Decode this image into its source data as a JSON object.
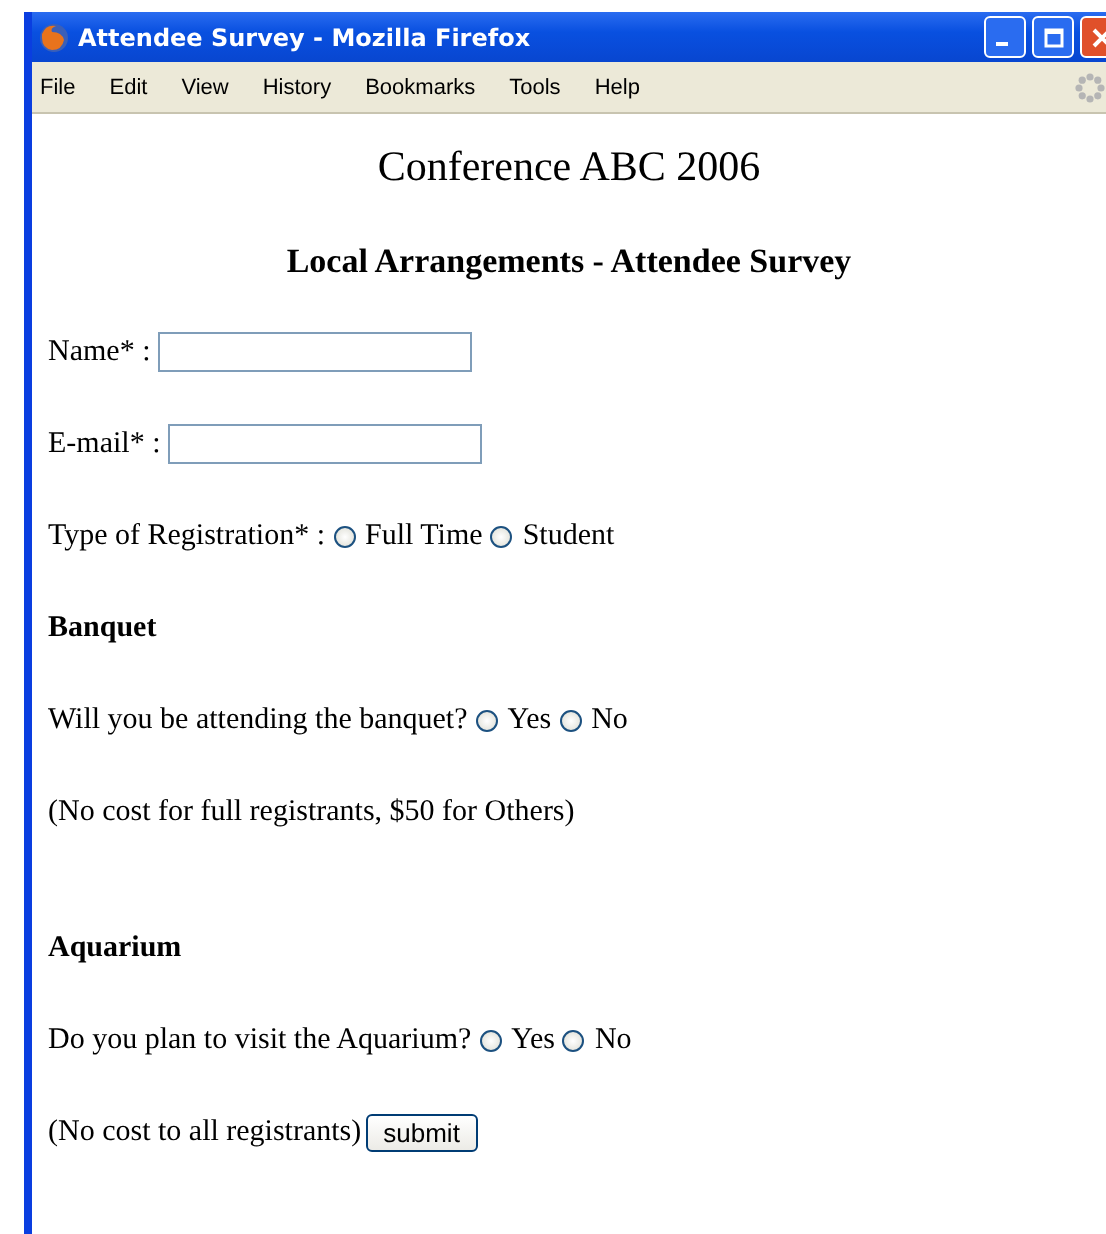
{
  "window": {
    "title": "Attendee Survey - Mozilla Firefox"
  },
  "menu": [
    "File",
    "Edit",
    "View",
    "History",
    "Bookmarks",
    "Tools",
    "Help"
  ],
  "page": {
    "title": "Conference ABC 2006",
    "subtitle": "Local Arrangements - Attendee Survey",
    "fields": [
      {
        "label": "Name* :"
      },
      {
        "label": "E-mail* :"
      }
    ],
    "registration": {
      "label": "Type of Registration* :",
      "options": [
        {
          "label": "Full Time",
          "selected": false
        },
        {
          "label": "Student",
          "selected": false
        }
      ]
    },
    "sections": [
      {
        "heading": "Banquet",
        "question": "Will you be attending the banquet?",
        "options": [
          {
            "label": "Yes",
            "selected": false
          },
          {
            "label": "No",
            "selected": false
          }
        ],
        "note": "(No cost for full registrants, $50 for Others)"
      },
      {
        "heading": "Aquarium",
        "question": "Do you plan to visit the Aquarium?",
        "options": [
          {
            "label": "Yes",
            "selected": false
          },
          {
            "label": "No",
            "selected": false
          }
        ],
        "note": "(No cost to all registrants)"
      }
    ],
    "submit": "submit"
  }
}
